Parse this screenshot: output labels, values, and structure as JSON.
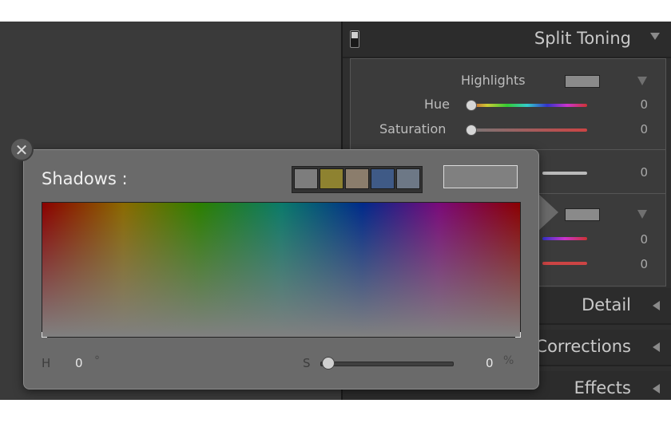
{
  "panels": {
    "split_toning": {
      "title": "Split Toning"
    },
    "detail": {
      "title": "Detail"
    },
    "lens_corrections": {
      "title": "Lens Corrections"
    },
    "effects": {
      "title": "Effects"
    }
  },
  "split_toning": {
    "highlights_label": "Highlights",
    "hue_label": "Hue",
    "saturation_label": "Saturation",
    "values": [
      "0",
      "0",
      "0",
      "0",
      "0"
    ]
  },
  "popup": {
    "title": "Shadows :",
    "h_label": "H",
    "h_value": "0",
    "h_unit": "°",
    "s_label": "S",
    "s_value": "0",
    "s_unit": "%",
    "close_glyph": "✕",
    "current_color": "#808080",
    "preset_swatches": [
      "#7d7d7d",
      "#8e8230",
      "#8b7d6c",
      "#3f5a86",
      "#6d7886"
    ]
  },
  "icons": [
    "close-icon",
    "switch-icon",
    "collapse-down-icon",
    "collapse-left-icon"
  ]
}
